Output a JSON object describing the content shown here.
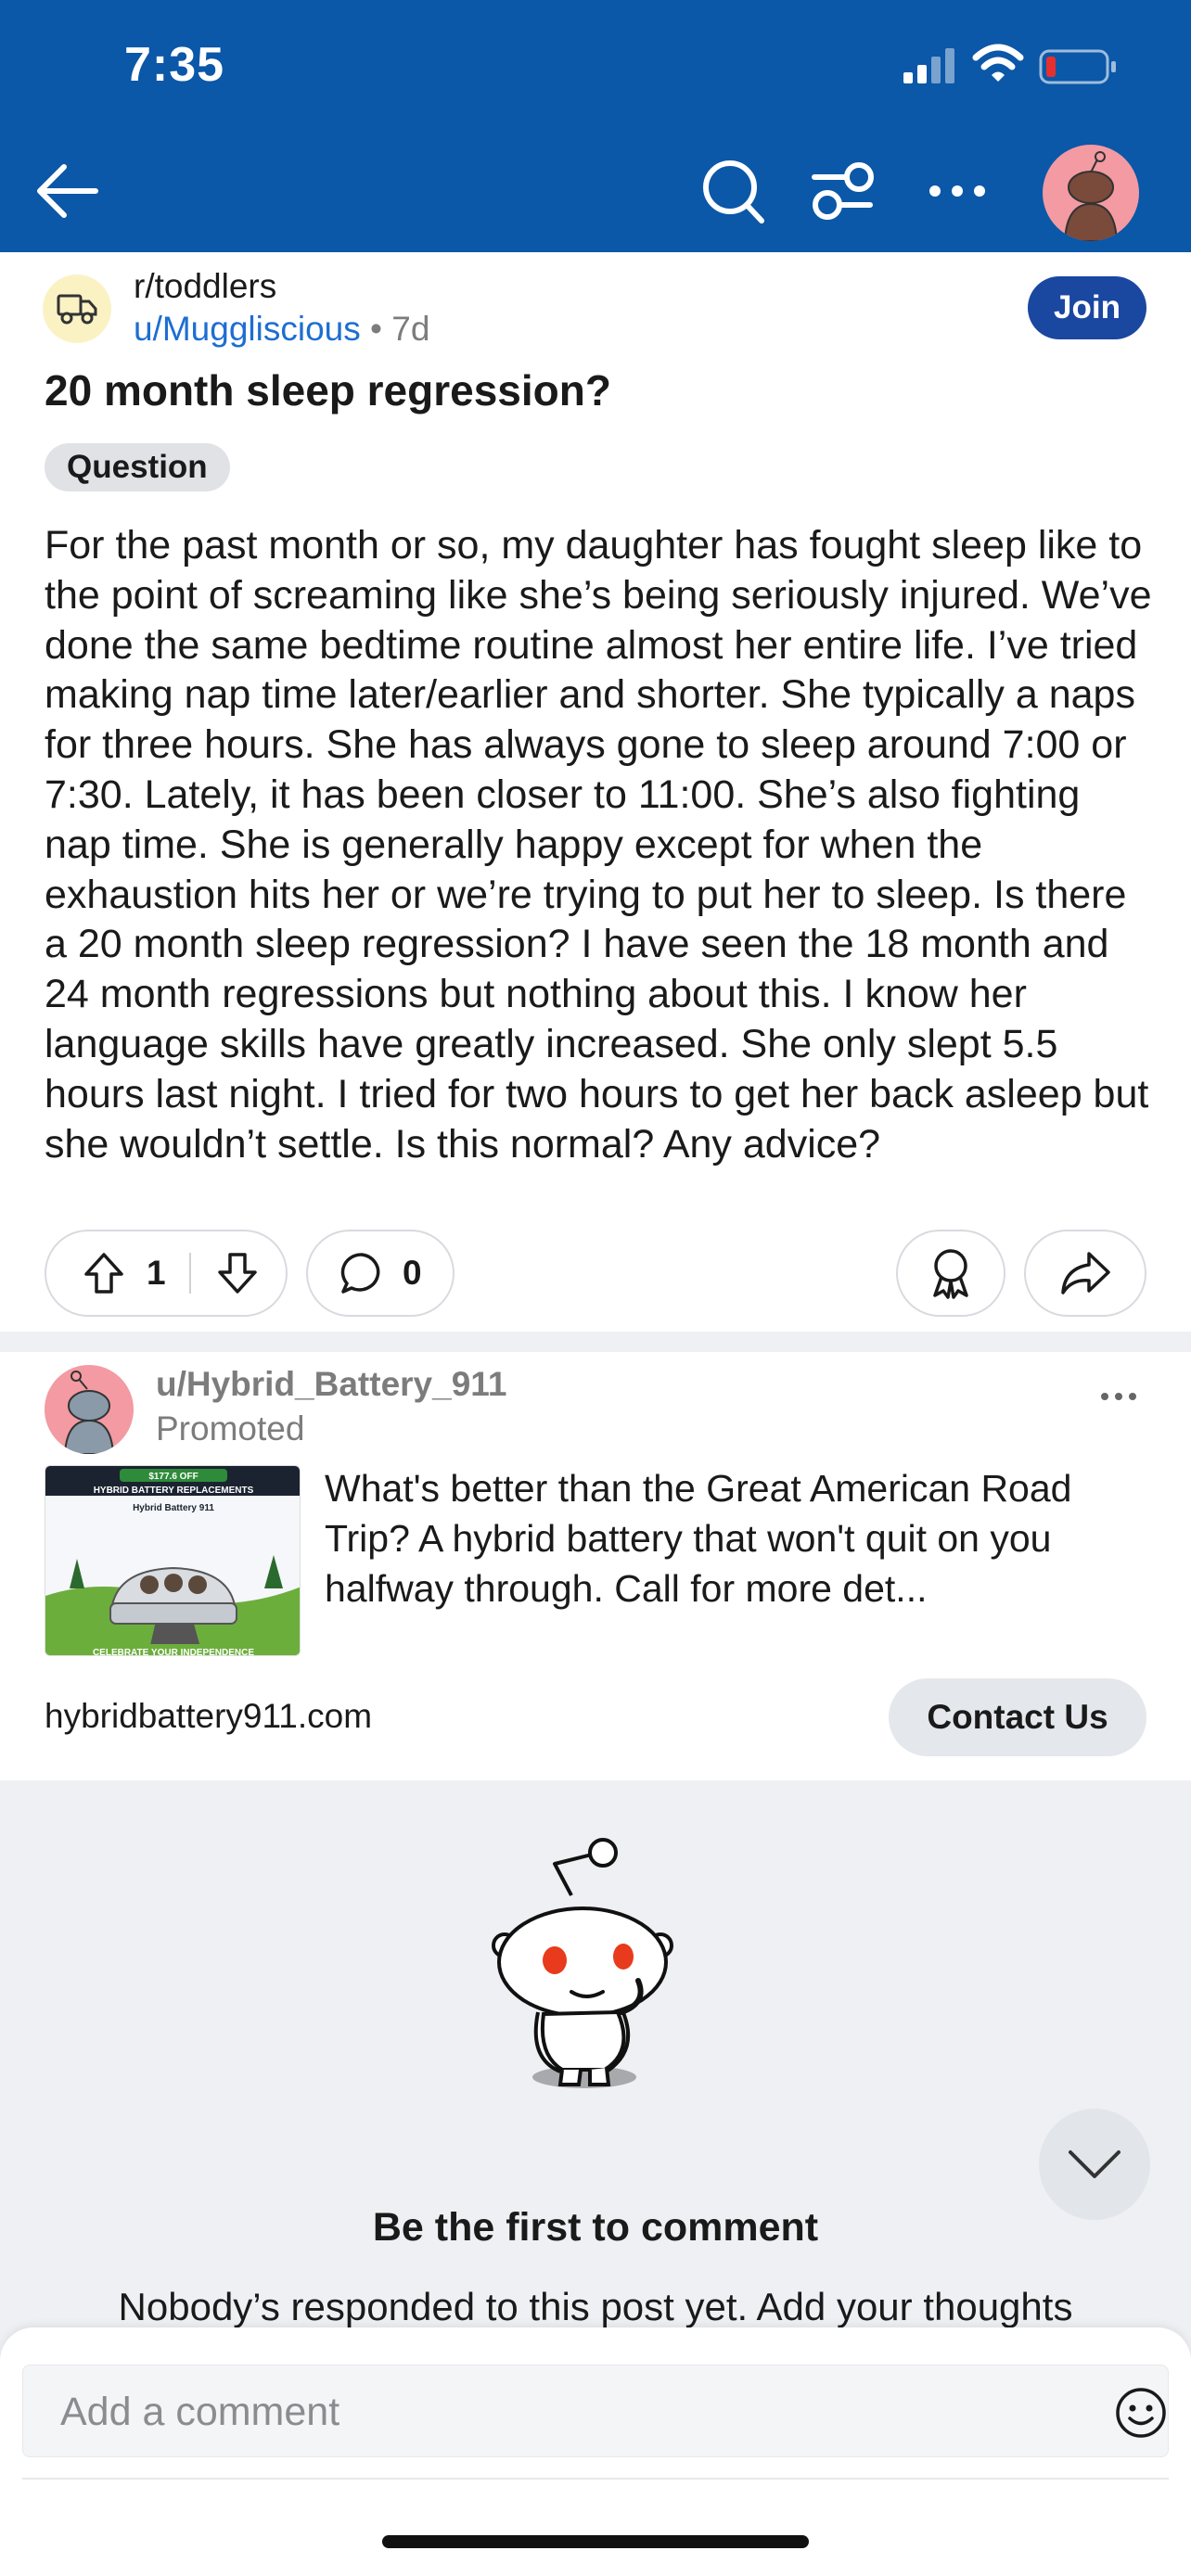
{
  "status_bar": {
    "time": "7:35"
  },
  "colors": {
    "header_bg": "#0b57a8",
    "join_bg": "#1a47a0",
    "link_blue": "#1d6ed1",
    "battery_low": "#e5302f"
  },
  "icons": {
    "back": "arrow-left-icon",
    "search": "search-icon",
    "filter": "filter-icon",
    "more": "more-horizontal-icon",
    "upvote": "arrow-up-icon",
    "downvote": "arrow-down-icon",
    "comment": "comment-bubble-icon",
    "award": "award-icon",
    "share": "share-arrow-icon",
    "emoji": "smiley-icon",
    "collapse": "chevron-down-icon"
  },
  "post": {
    "subreddit": "r/toddlers",
    "author": "u/Muggliscious",
    "age_separator": " • ",
    "age": "7d",
    "join_label": "Join",
    "title": "20 month sleep regression?",
    "flair": "Question",
    "body": "For the past month or so, my daughter has fought sleep like to the point of screaming like she’s being seriously injured. We’ve done the same bedtime routine almost her entire life. I’ve tried making nap time later/earlier and shorter. She typically a naps for three hours. She has always gone to sleep around 7:00 or 7:30. Lately, it has been closer to 11:00. She’s also fighting nap time. She is generally happy except for when the exhaustion hits her or we’re trying to put her to sleep. Is there a 20 month sleep regression? I have seen the 18 month and 24 month regressions but nothing about this. I know her language skills have greatly increased. She only slept 5.5 hours last night. I tried for two hours to get her back asleep but she wouldn’t settle. Is this normal? Any advice?",
    "votes": "1",
    "comments": "0"
  },
  "ad": {
    "user": "u/Hybrid_Battery_911",
    "promoted_label": "Promoted",
    "image_text": {
      "price": "$177.6 OFF",
      "headline": "HYBRID BATTERY REPLACEMENTS",
      "brand": "Hybrid Battery 911",
      "footer": "CELEBRATE YOUR INDEPENDENCE"
    },
    "text": "What's better than the Great American Road Trip? A hybrid battery that won't quit on you halfway through. Call for more det...",
    "domain": "hybridbattery911.com",
    "cta": "Contact Us"
  },
  "empty_state": {
    "title": "Be the first to comment",
    "subtitle": "Nobody’s responded to this post yet. Add your thoughts"
  },
  "composer": {
    "placeholder": "Add a comment"
  }
}
